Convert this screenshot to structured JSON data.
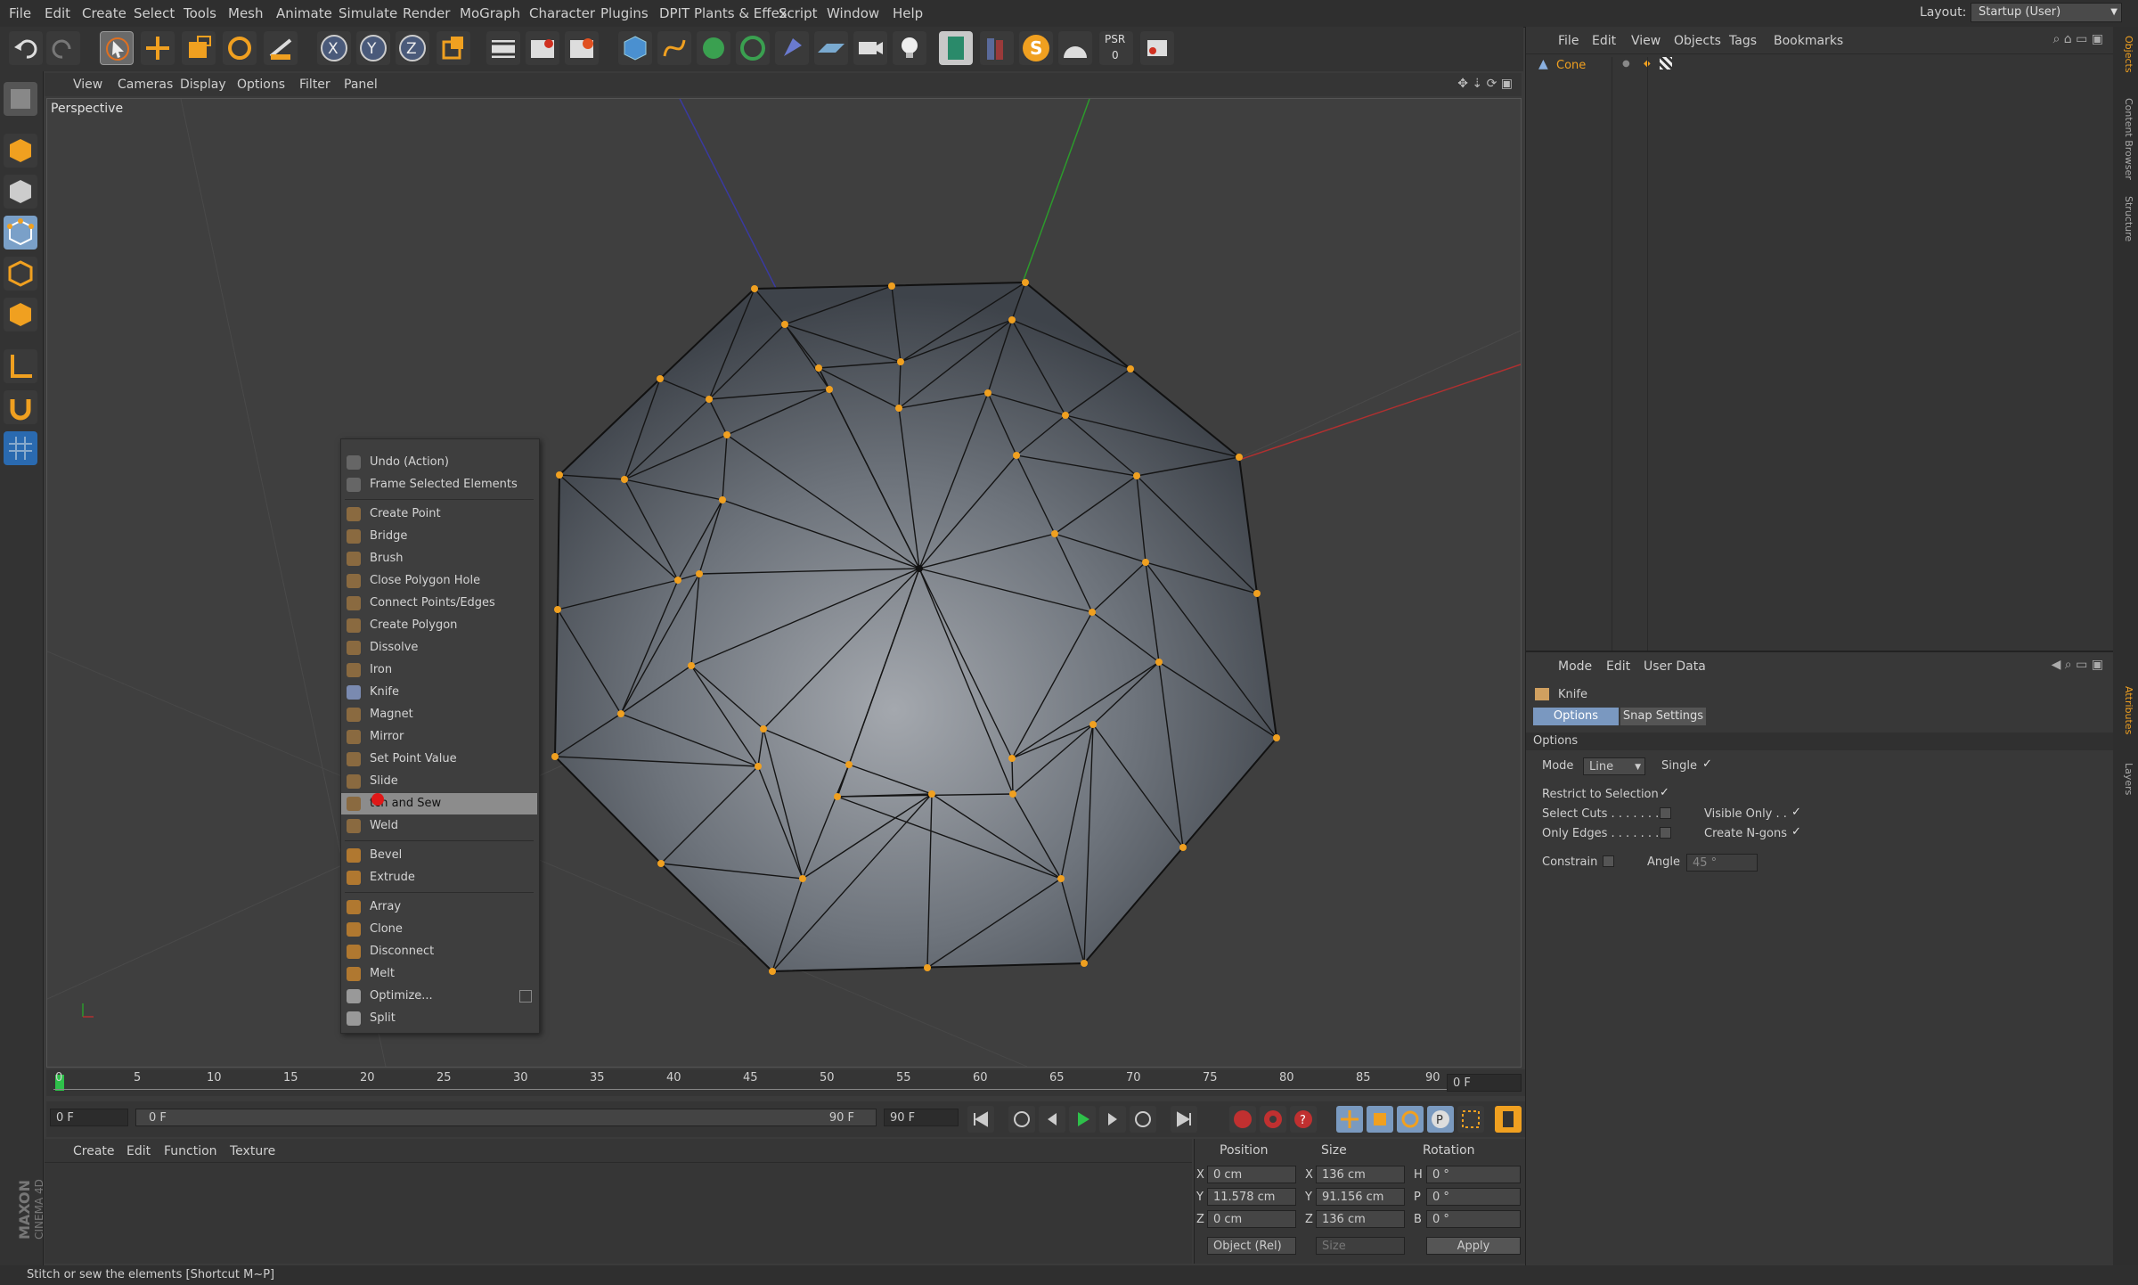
{
  "menubar": {
    "items": [
      "File",
      "Edit",
      "Create",
      "Select",
      "Tools",
      "Mesh",
      "Animate",
      "Simulate",
      "Render",
      "MoGraph",
      "Character",
      "Plugins",
      "DPIT Plants & Effex",
      "Script",
      "Window",
      "Help"
    ],
    "layout_label": "Layout:",
    "layout_value": "Startup (User)"
  },
  "toolbar": {
    "icons": [
      "undo-icon",
      "redo-icon",
      "live-selection-icon",
      "move-icon",
      "scale-icon",
      "rotate-icon",
      "recent-tools-icon",
      "x-axis-lock-icon",
      "y-axis-lock-icon",
      "z-axis-lock-icon",
      "coordinate-system-icon",
      "render-view-icon",
      "render-picture-viewer-icon",
      "render-settings-icon",
      "cube-icon",
      "spline-pen-icon",
      "subdivision-icon",
      "array-icon",
      "deformer-icon",
      "floor-icon",
      "camera-icon",
      "light-icon",
      "plugin-icon",
      "bookshelf-icon",
      "s-plugin-icon",
      "dome-icon",
      "psr-icon",
      "tag-icon"
    ],
    "psr_label": "PSR",
    "psr_value": "0"
  },
  "leftbar": {
    "icons": [
      "make-editable-icon",
      "model-mode-icon",
      "texture-mode-icon",
      "points-mode-icon",
      "edges-mode-icon",
      "polygons-mode-icon",
      "axis-mode-icon",
      "snap-icon",
      "workplane-icon"
    ]
  },
  "viewport": {
    "menu": [
      "View",
      "Cameras",
      "Display",
      "Options",
      "Filter",
      "Panel"
    ],
    "label": "Perspective"
  },
  "context_menu": {
    "groups": [
      [
        "Undo (Action)",
        "Frame Selected Elements"
      ],
      [
        "Create Point",
        "Bridge",
        "Brush",
        "Close Polygon Hole",
        "Connect Points/Edges",
        "Create Polygon",
        "Dissolve",
        "Iron",
        "Knife",
        "Magnet",
        "Mirror",
        "Set Point Value",
        "Slide",
        "Stitch and Sew",
        "Weld"
      ],
      [
        "Bevel",
        "Extrude"
      ],
      [
        "Array",
        "Clone",
        "Disconnect",
        "Melt",
        "Optimize...",
        "Split"
      ]
    ],
    "highlighted_display": "tch and Sew"
  },
  "timeline": {
    "ticks": [
      "0",
      "5",
      "10",
      "15",
      "20",
      "25",
      "30",
      "35",
      "40",
      "45",
      "50",
      "55",
      "60",
      "65",
      "70",
      "75",
      "80",
      "85",
      "90"
    ],
    "current_frame": "0 F"
  },
  "transport": {
    "start_field": "0 F",
    "range_start": "0 F",
    "range_end": "90 F",
    "end_field": "90 F"
  },
  "material_manager": {
    "menu": [
      "Create",
      "Edit",
      "Function",
      "Texture"
    ],
    "brand_top": "MAXON",
    "brand_bottom": "CINEMA 4D"
  },
  "coordinates": {
    "headers": [
      "Position",
      "Size",
      "Rotation"
    ],
    "rows": [
      {
        "axis": "X",
        "pos": "0 cm",
        "size_axis": "X",
        "size": "136 cm",
        "rot_axis": "H",
        "rot": "0 °"
      },
      {
        "axis": "Y",
        "pos": "11.578 cm",
        "size_axis": "Y",
        "size": "91.156 cm",
        "rot_axis": "P",
        "rot": "0 °"
      },
      {
        "axis": "Z",
        "pos": "0 cm",
        "size_axis": "Z",
        "size": "136 cm",
        "rot_axis": "B",
        "rot": "0 °"
      }
    ],
    "mode_select": "Object (Rel)",
    "size_select": "Size",
    "apply": "Apply"
  },
  "object_manager": {
    "menu": [
      "File",
      "Edit",
      "View",
      "Objects",
      "Tags",
      "Bookmarks"
    ],
    "object_name": "Cone"
  },
  "attributes": {
    "menu": [
      "Mode",
      "Edit",
      "User Data"
    ],
    "tool_name": "Knife",
    "tabs": [
      "Options",
      "Snap Settings"
    ],
    "section": "Options",
    "mode_label": "Mode",
    "mode_value": "Line",
    "single_label": "Single",
    "restrict_label": "Restrict to Selection",
    "select_cuts_label": "Select Cuts . . . . . . . .",
    "visible_only_label": "Visible Only . .",
    "only_edges_label": "Only Edges . . . . . . .",
    "create_ngons_label": "Create N-gons",
    "constrain_label": "Constrain",
    "angle_label": "Angle",
    "angle_value": "45 °"
  },
  "right_tabs": [
    "Objects",
    "Content Browser",
    "Structure",
    "Attributes",
    "Layers"
  ],
  "status": "Stitch or sew the elements [Shortcut M~P]",
  "colors": {
    "background": "#3b3b3b",
    "vertex": "#f0a020",
    "highlight": "#8c8c8c",
    "x_axis": "#b03030",
    "y_axis": "#2c9a2c",
    "z_axis": "#3a3aa0"
  }
}
